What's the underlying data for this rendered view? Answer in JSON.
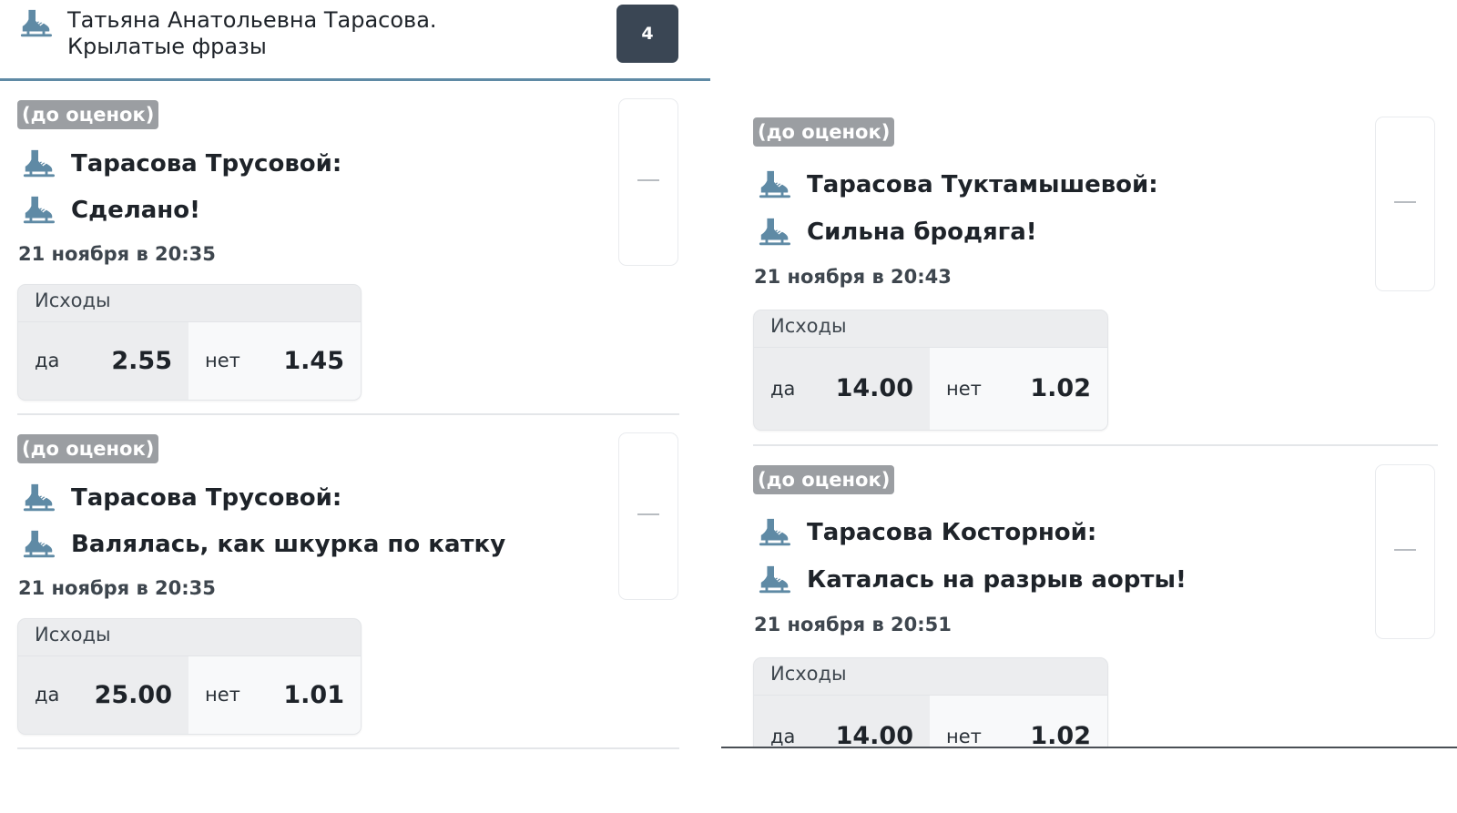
{
  "header": {
    "icon": "skate-icon",
    "title": "Татьяна Анатольевна Тарасова.\nКрылатые фразы",
    "count": "4"
  },
  "colors": {
    "accent_line": "#5f8aa5",
    "badge_bg": "#3a4654",
    "status_tag_bg": "#9b9ea2",
    "skate_icon": "#5f8aa5"
  },
  "markets": [
    {
      "status": "(до оценок)",
      "lines": [
        "Тарасова Трусовой:",
        "Сделано!"
      ],
      "date": "21 ноября в 20:35",
      "outcomes_label": "Исходы",
      "yes_label": "да",
      "yes_odds": "2.55",
      "no_label": "нет",
      "no_odds": "1.45",
      "side_icon": "dash-icon"
    },
    {
      "status": "(до оценок)",
      "lines": [
        "Тарасова Трусовой:",
        "Валялась, как шкурка по катку"
      ],
      "date": "21 ноября в 20:35",
      "outcomes_label": "Исходы",
      "yes_label": "да",
      "yes_odds": "25.00",
      "no_label": "нет",
      "no_odds": "1.01",
      "side_icon": "dash-icon"
    },
    {
      "status": "(до оценок)",
      "lines": [
        "Тарасова Туктамышевой:",
        "Сильна бродяга!"
      ],
      "date": "21 ноября в 20:43",
      "outcomes_label": "Исходы",
      "yes_label": "да",
      "yes_odds": "14.00",
      "no_label": "нет",
      "no_odds": "1.02",
      "side_icon": "dash-icon"
    },
    {
      "status": "(до оценок)",
      "lines": [
        "Тарасова Косторной:",
        "Каталась на разрыв аорты!"
      ],
      "date": "21 ноября в 20:51",
      "outcomes_label": "Исходы",
      "yes_label": "да",
      "yes_odds": "14.00",
      "no_label": "нет",
      "no_odds": "1.02",
      "side_icon": "dash-icon"
    }
  ]
}
